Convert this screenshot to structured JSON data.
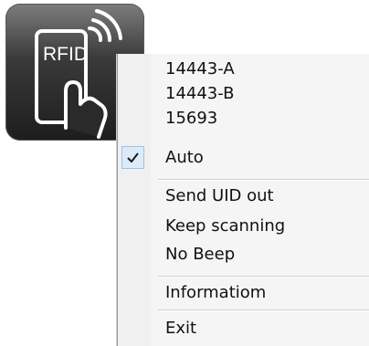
{
  "app_icon": {
    "label": "RFID",
    "icon": "rfid-tap-icon"
  },
  "context_menu": {
    "items": [
      {
        "label": "14443-A",
        "checked": false
      },
      {
        "label": "14443-B",
        "checked": false
      },
      {
        "label": "15693",
        "checked": false
      },
      {
        "label": "Auto",
        "checked": true
      },
      {
        "label": "Send UID out",
        "checked": false
      },
      {
        "label": "Keep scanning",
        "checked": false
      },
      {
        "label": "No Beep",
        "checked": false
      },
      {
        "label": "Informatiom",
        "checked": false
      },
      {
        "label": "Exit",
        "checked": false
      }
    ]
  }
}
